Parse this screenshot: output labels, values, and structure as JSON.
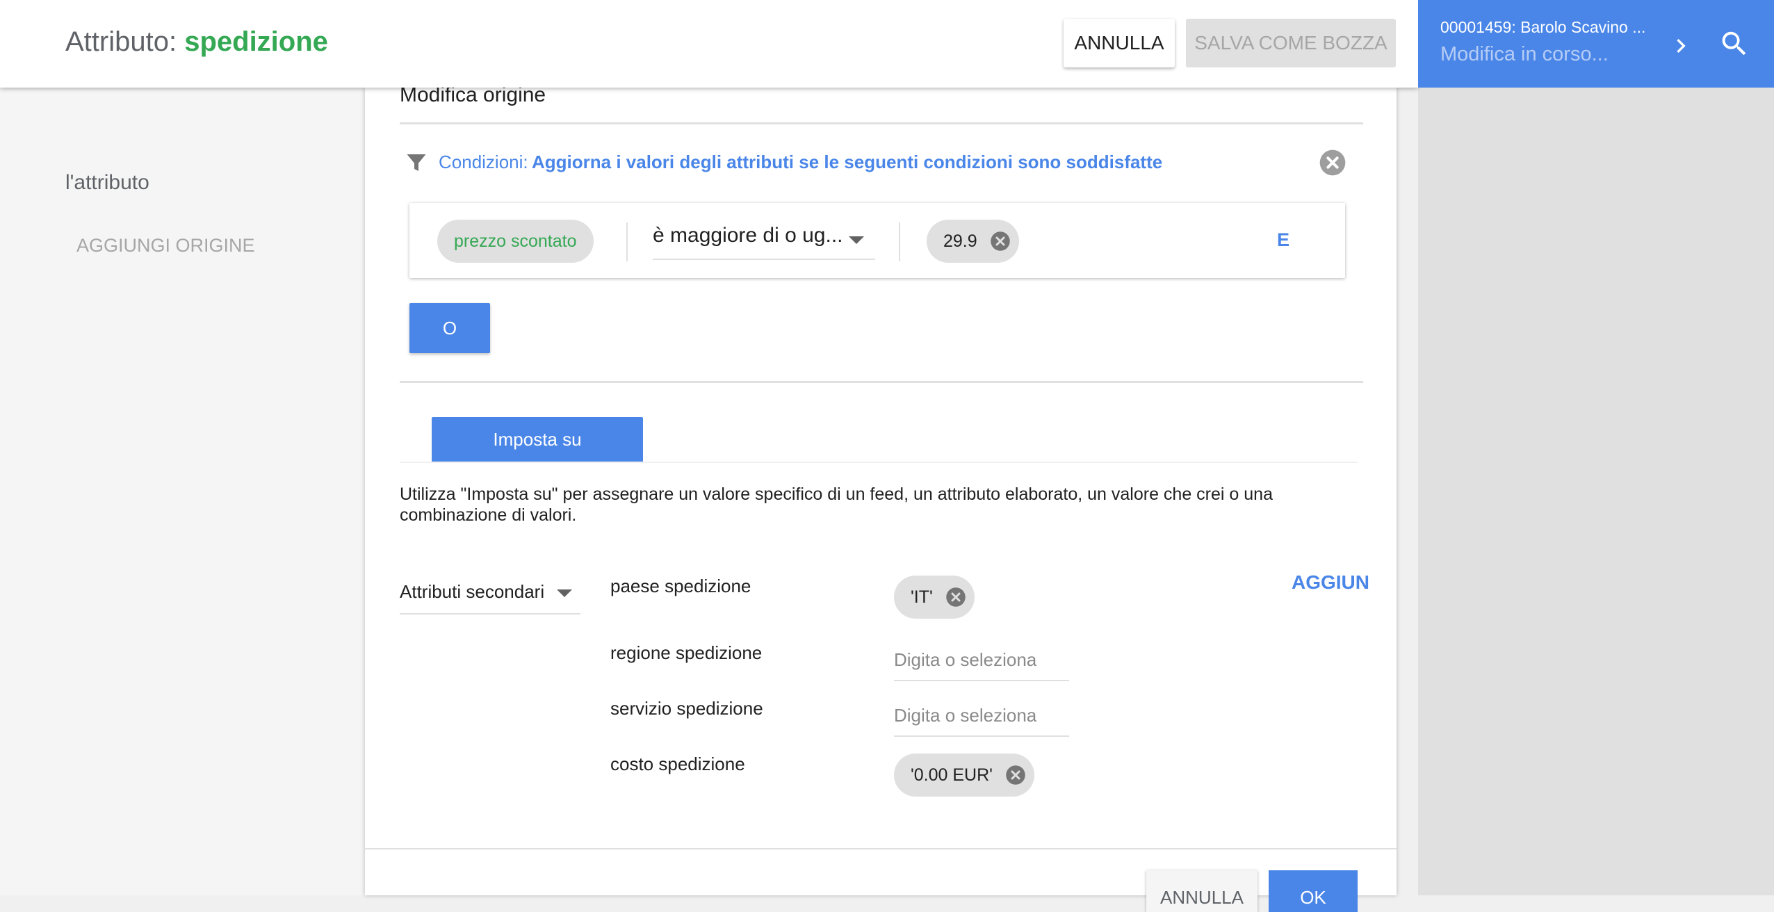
{
  "header": {
    "title_prefix": "Attributo: ",
    "title_value": "spedizione",
    "cancel_label": "ANNULLA",
    "draft_label": "SALVA COME BOZZA"
  },
  "right_panel": {
    "title": "00001459: Barolo Scavino ...",
    "status": "Modifica in corso...",
    "icons": [
      "chevron-right-icon",
      "search-icon"
    ],
    "bg_color": "#4a86e8"
  },
  "left_pane": {
    "text": "l'attributo",
    "add_origin_label": "AGGIUNGI ORIGINE"
  },
  "dialog": {
    "section_title": "Modifica origine",
    "conditions": {
      "label": "Condizioni:",
      "text": "Aggiorna i valori degli attributi se le seguenti condizioni sono soddisfatte",
      "row": {
        "attribute": "prezzo scontato",
        "operator": "è maggiore di o ug...",
        "value": "29.9",
        "and_label": "E"
      },
      "or_label": "O"
    },
    "tab_label": "Imposta su",
    "description": "Utilizza \"Imposta su\" per assegnare un valore specifico di un feed, un attributo elaborato, un valore che crei o una combinazione di valori.",
    "attr_dropdown": "Attributi secondari",
    "add_label": "AGGIUN",
    "fields": [
      {
        "label": "paese spedizione",
        "chip": "'IT'"
      },
      {
        "label": "regione spedizione",
        "placeholder": "Digita o seleziona"
      },
      {
        "label": "servizio spedizione",
        "placeholder": "Digita o seleziona"
      },
      {
        "label": "costo spedizione",
        "chip": "'0.00 EUR'"
      }
    ],
    "footer": {
      "cancel_label": "ANNULLA",
      "ok_label": "OK"
    }
  },
  "colors": {
    "accent_blue": "#4a86e8",
    "accent_green": "#34a853"
  }
}
